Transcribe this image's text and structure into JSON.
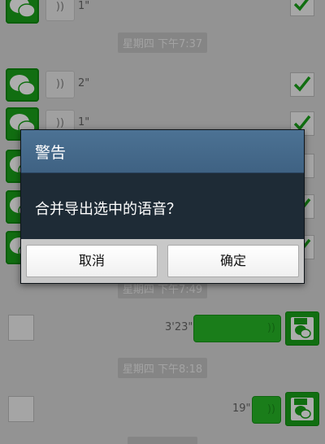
{
  "messages": {
    "row0": {
      "duration": "1\""
    },
    "timestamp1": "星期四 下午7:37",
    "row1": {
      "duration": "2\""
    },
    "row2": {
      "duration": "1\""
    },
    "timestamp2": "星期四 下午7:49",
    "out1": {
      "duration": "3'23\""
    },
    "timestamp3": "星期四 下午8:18",
    "out2": {
      "duration": "19\""
    }
  },
  "voice_glyph": "))",
  "dialog": {
    "title": "警告",
    "message": "合并导出选中的语音？",
    "cancel_label": "取消",
    "ok_label": "确定"
  },
  "colors": {
    "accent_green": "#1aa31a",
    "dialog_title_bg": "#4c7294",
    "dialog_body_bg": "#1e2b36"
  }
}
